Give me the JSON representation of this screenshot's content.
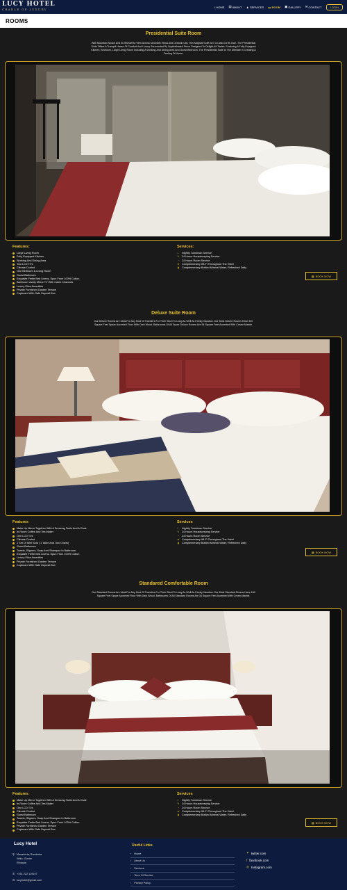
{
  "header": {
    "brand": "LUCY HOTEL",
    "tagline": "CRADLE OF LUXURY",
    "nav": [
      {
        "label": "HOME",
        "icon": "home-icon",
        "glyph": "⌂"
      },
      {
        "label": "ABOUT",
        "icon": "about-icon",
        "glyph": "▤"
      },
      {
        "label": "SERVICES",
        "icon": "services-icon",
        "glyph": "▲"
      },
      {
        "label": "ROOM",
        "icon": "bed-icon",
        "glyph": "▬"
      },
      {
        "label": "GALLERY",
        "icon": "gallery-icon",
        "glyph": "▣"
      },
      {
        "label": "CONTACT",
        "icon": "contact-icon",
        "glyph": "✉"
      }
    ],
    "active_nav": "ROOM",
    "login": "LOGIN",
    "accent": "#e8c230",
    "nav_bg": "#0d1b3e"
  },
  "page_title": "ROOMS",
  "rooms": [
    {
      "title": "Presidential Suite Room",
      "description": "With Mountain Space And Its Wonderful View Across Mountain Tessa And Oceanic City, This Magical Suite Is In A Class Of Its Own. The Presidential Suite Offers A Tranquil Haven Of Comfort And Luxury Surrounded By Sophisticated Decor Designed To Delight All Tastes. Featuring A Fully Equipped Kitchen, Bedroom, Large Living Room Including A Working And Dining Area And Guest Bedroom, The Presidential Suite Is The Ultimate In Creating A Feeling Of Home.",
      "features_heading": "Features:",
      "features": [
        "Large Living Room",
        "Fully Equipped Kitchen",
        "Working And Dining Area",
        "Two LCD TVs",
        "Climate Control",
        "One Bedroom & Living Room",
        "Guest Bathroom",
        "Exquisite Frette Bed Linens, Spun From 100% Cotton",
        "Bathroom Vanity Mirror TV With Cable Channels",
        "Luxury Elios Amenities",
        "Private Furnished Garden Terrace",
        "Cupboard With Safe Deposit Box"
      ],
      "services_heading": "Services:",
      "services": [
        "Nightly Turndown Service",
        "24 Hours Housekeeping Service",
        "24 Hours Room Service",
        "Complementary Wi-Fi Throughout The Hotel",
        "Complementary Bottled Mineral Water, Refreshed Daily"
      ],
      "book": "BOOK NOW"
    },
    {
      "title": "Deluxe Suite Room",
      "description": "Our Deluxe Rooms Are Ideal For Any Kind Of Travelers For Their Short To Long As Well As Family Vacation. Our Most Deluxe Rooms Have 320 Square Feet Space Accented Floor With Dark Wood. Bathrooms Of All Super Deluxe Rooms Are 54 Square Feet Accented With Cream Marble.",
      "features_heading": "Features",
      "features": [
        "Make Up Mirror Together With A Dressing Table And A Chair",
        "In-Room Coffee And Tea Maker",
        "One LCD TVs",
        "Climate Control",
        "1 Set Of Mini Sofa ( 1 Table And Two Chairs)",
        "Guest Bathroom",
        "Towels, Slippers, Soap And Shampoo In Bathroom",
        "Exquisite Frette Bed Linens, Spun From 100% Cotton",
        "Luxury Elios Amenities",
        "Private Furnished Garden Terrace",
        "Cupboard With Safe Deposit Box"
      ],
      "services_heading": "Services",
      "services": [
        "Nightly Turndown Service",
        "24 Hours Housekeeping Service",
        "24 Hours Room Service",
        "Complementary Wi-Fi Throughout The Hotel",
        "Complementary Bottled Mineral Water, Refreshed Daily"
      ],
      "book": "BOOK NOW"
    },
    {
      "title": "Standared Comfortable Room",
      "description": "Our Standard Rooms Are Ideal For Any Kind Of Travelers For Their Short To Long As Well As Family Vacation. Our Most Standard Rooms Have 160 Square Feet Space Accented Floor With Dark Wood. Bathrooms Of All Standard Rooms Are 34 Square Feet Accented With Cream Marble.",
      "features_heading": "Features",
      "features": [
        "Make Up Mirror Together With A Dressing Table And A Chair",
        "In-Room Coffee And Tea Maker",
        "One LCD TVs",
        "Climate Control",
        "Guest Bathroom",
        "Towels, Slippers, Soap And Shampoo In Bathroom",
        "Exquisite Frette Bed Linens, Spun From 100% Cotton",
        "Private Furnished Garden Terrace",
        "Cupboard With Safe Deposit Box"
      ],
      "services_heading": "Services",
      "services": [
        "Nightly Turndown Service",
        "24 Hours Housekeeping Service",
        "24 Hours Room Service",
        "Complementary Wi-Fi Throughout The Hotel",
        "Complementary Bottled Mineral Water, Refreshed Daily"
      ],
      "book": "BOOK NOW"
    }
  ],
  "service_icons": [
    "moon-icon",
    "broom-icon",
    "bell-icon",
    "wifi-icon",
    "bottle-icon"
  ],
  "footer": {
    "title": "Lucy Hotel",
    "address": [
      "Menaherta, Bumbuka",
      "Walo, Gonne",
      "Ethiopia"
    ],
    "phone": "+251 222 119197",
    "email": "lucyhotel@gmail.com",
    "links_title": "Useful Links",
    "links": [
      "Home",
      "About Us",
      "Services",
      "Term Of Service",
      "Privacy Policy"
    ],
    "social": [
      {
        "label": "twitter.com",
        "icon": "twitter-icon",
        "glyph": "✦"
      },
      {
        "label": "facebook.com",
        "icon": "facebook-icon",
        "glyph": "f"
      },
      {
        "label": "Instagram.com",
        "icon": "instagram-icon",
        "glyph": "◎"
      }
    ]
  }
}
